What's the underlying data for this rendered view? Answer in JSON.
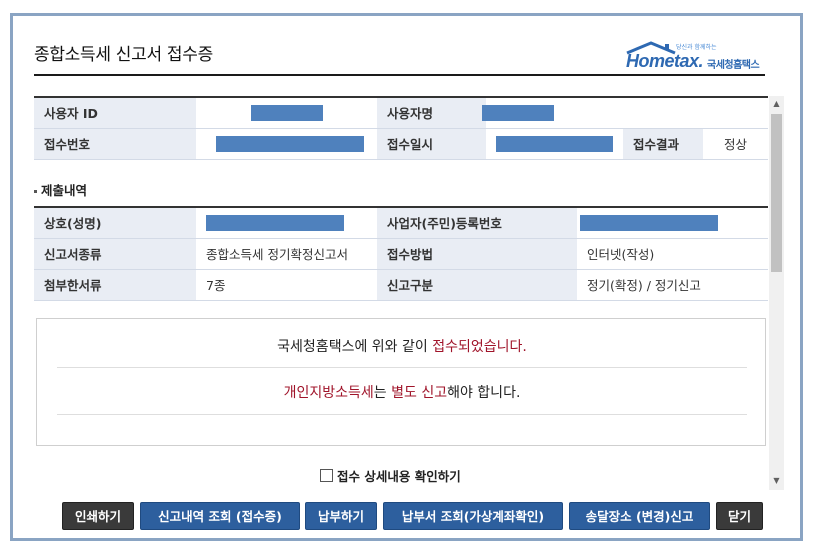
{
  "window": {
    "title": "종합소득세 신고서 접수증"
  },
  "logo": {
    "brand": "Hometax.",
    "sub": "국세청홈택스",
    "tagline": "당신과 함께하는"
  },
  "receipt_info": {
    "user_id_label": "사용자 ID",
    "user_name_label": "사용자명",
    "receipt_no_label": "접수번호",
    "receipt_date_label": "접수일시",
    "receipt_result_label": "접수결과",
    "receipt_result_value": "정상"
  },
  "submission": {
    "section_title": "제출내역",
    "name_label": "상호(성명)",
    "reg_no_label": "사업자(주민)등록번호",
    "report_type_label": "신고서종류",
    "report_type_value": "종합소득세 정기확정신고서",
    "method_label": "접수방법",
    "method_value": "인터넷(작성)",
    "attachments_label": "첨부한서류",
    "attachments_value": "7종",
    "category_label": "신고구분",
    "category_value": "정기(확정) / 정기신고"
  },
  "notice": {
    "line1_prefix": "국세청홈택스에 위와 같이 ",
    "line1_highlight": "접수되었습니다.",
    "line2_part1": "개인지방소득세",
    "line2_part2": "는 ",
    "line2_part3": "별도 신고",
    "line2_part4": "해야 합니다."
  },
  "confirm_checkbox": {
    "label": "접수 상세내용 확인하기",
    "checked": false
  },
  "buttons": {
    "print": "인쇄하기",
    "history": "신고내역 조회 (접수증)",
    "pay": "납부하기",
    "bill_lookup": "납부서 조회(가상계좌확인)",
    "address_change": "송달장소 (변경)신고",
    "close": "닫기"
  },
  "colors": {
    "accent": "#2d5f9e",
    "highlight_red": "#a0142a",
    "redaction": "#4f81bd"
  }
}
